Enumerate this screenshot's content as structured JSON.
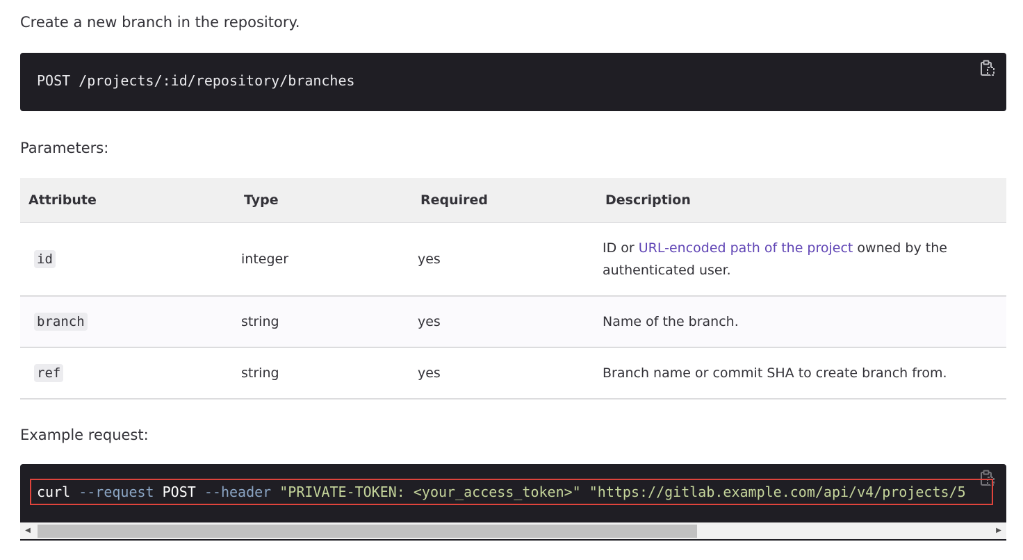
{
  "intro": "Create a new branch in the repository.",
  "endpoint": {
    "code": "POST /projects/:id/repository/branches",
    "copy_icon": "clipboard-icon"
  },
  "parameters_label": "Parameters:",
  "table": {
    "headers": [
      "Attribute",
      "Type",
      "Required",
      "Description"
    ],
    "rows": [
      {
        "attribute": "id",
        "type": "integer",
        "required": "yes",
        "description_prefix": "ID or ",
        "description_link": "URL-encoded path of the project",
        "description_suffix": " owned by the authenticated user."
      },
      {
        "attribute": "branch",
        "type": "string",
        "required": "yes",
        "description": "Name of the branch."
      },
      {
        "attribute": "ref",
        "type": "string",
        "required": "yes",
        "description": "Branch name or commit SHA to create branch from."
      }
    ]
  },
  "example_label": "Example request:",
  "example": {
    "cmd": "curl",
    "flag1": "--request",
    "method": "POST",
    "flag2": "--header",
    "header_value": "\"PRIVATE-TOKEN: <your_access_token>\"",
    "url": "\"https://gitlab.example.com/api/v4/projects/5",
    "copy_icon": "clipboard-icon"
  },
  "colors": {
    "code_bg": "#1f1e24",
    "link": "#6045b5",
    "highlight_border": "#e0443c",
    "string": "#c5d59b",
    "flag": "#8ba5c4"
  }
}
